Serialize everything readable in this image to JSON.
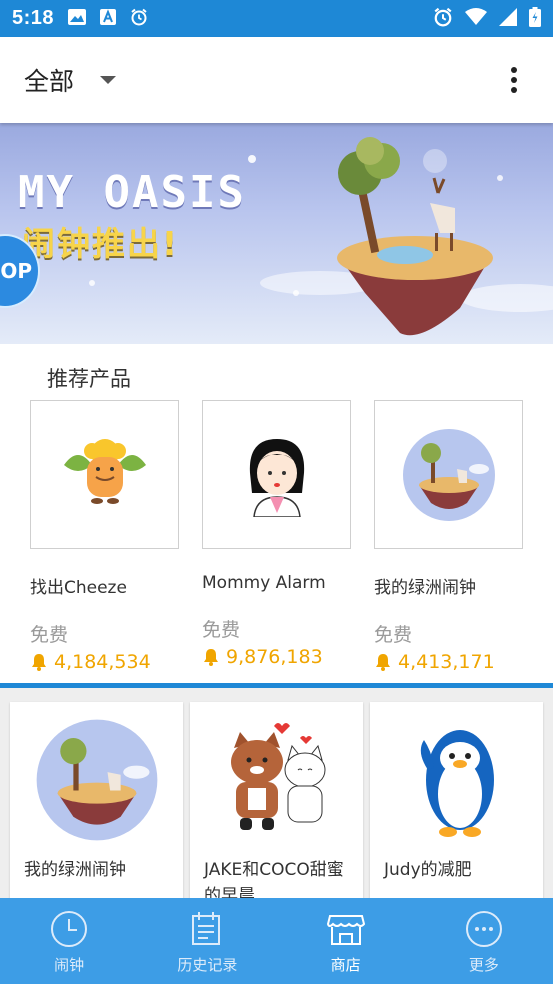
{
  "status_bar": {
    "time": "5:18"
  },
  "app_bar": {
    "title": "全部"
  },
  "banner": {
    "headline": "MY OASIS",
    "subline": "闹钟推出!",
    "badge": "OP"
  },
  "recommended": {
    "title": "推荐产品",
    "items": [
      {
        "name": "找出Cheeze",
        "price": "免费",
        "count": "4,184,534",
        "icon": "cheeze-character-icon"
      },
      {
        "name": "Mommy Alarm",
        "price": "免费",
        "count": "9,876,183",
        "icon": "mommy-character-icon"
      },
      {
        "name": "我的绿洲闹钟",
        "price": "免费",
        "count": "4,413,171",
        "icon": "oasis-island-icon"
      }
    ]
  },
  "grid": {
    "items": [
      {
        "name": "我的绿洲闹钟",
        "icon": "oasis-island-icon"
      },
      {
        "name": "JAKE和COCO甜蜜的早晨",
        "icon": "cats-couple-icon"
      },
      {
        "name": "Judy的减肥",
        "icon": "penguin-icon"
      }
    ]
  },
  "bottom_nav": {
    "items": [
      {
        "label": "闹钟",
        "icon": "clock-icon",
        "active": false
      },
      {
        "label": "历史记录",
        "icon": "calendar-icon",
        "active": false
      },
      {
        "label": "商店",
        "icon": "store-icon",
        "active": true
      },
      {
        "label": "更多",
        "icon": "more-dots-icon",
        "active": false
      }
    ]
  },
  "colors": {
    "primary": "#1e88d6",
    "nav_bg": "#3d9de6",
    "coin": "#f0a500",
    "price_gray": "#9a9a9a"
  }
}
